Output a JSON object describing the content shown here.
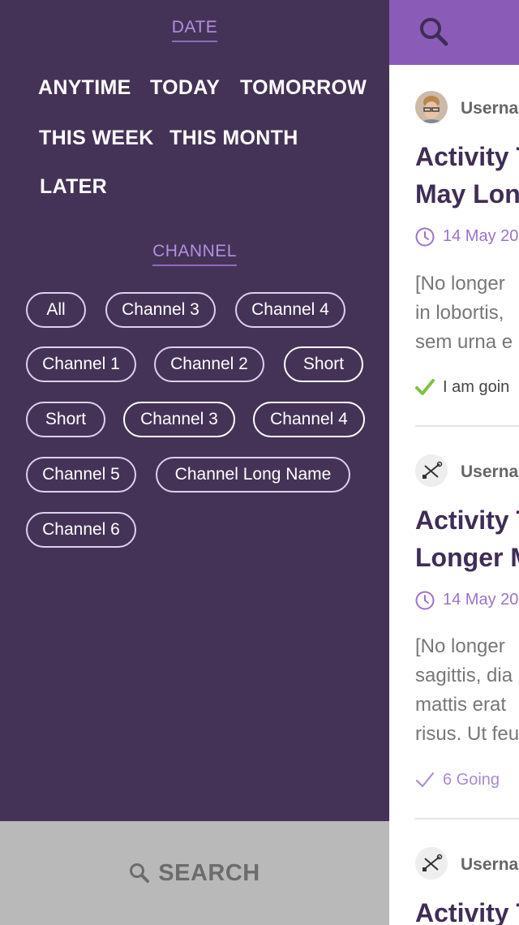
{
  "filters": {
    "date": {
      "title": "DATE",
      "options": [
        "ANYTIME",
        "TODAY",
        "TOMORROW",
        "THIS WEEK",
        "THIS MONTH",
        "LATER"
      ]
    },
    "channel": {
      "title": "CHANNEL",
      "chips": [
        "All",
        "Channel 3",
        "Channel 4",
        "Channel 1",
        "Channel 2",
        "Short",
        "Short",
        "Channel 3",
        "Channel 4",
        "Channel 5",
        "Channel Long Name",
        "Channel 6"
      ]
    },
    "search_label": "SEARCH"
  },
  "activities": [
    {
      "username": "Userna",
      "title_lines": [
        "Activity T",
        "May Lon"
      ],
      "date": "14 May 20",
      "desc_lines": [
        "[No longer",
        "in lobortis,",
        "sem urna e"
      ],
      "status": "I am goin"
    },
    {
      "username": "Userna",
      "title_lines": [
        "Activity T",
        "Longer M"
      ],
      "date": "14 May 20",
      "desc_lines": [
        "[No longer",
        "sagittis, dia",
        "mattis erat",
        "risus. Ut feu"
      ],
      "status": "6 Going"
    },
    {
      "username": "Userna",
      "title_lines": [
        "Activity T"
      ]
    }
  ],
  "colors": {
    "panel_bg": "#453357",
    "accent": "#8a5cb8",
    "accent_text": "#b28fe0",
    "going_green": "#7fc241",
    "search_bg": "#b9b9b9"
  }
}
